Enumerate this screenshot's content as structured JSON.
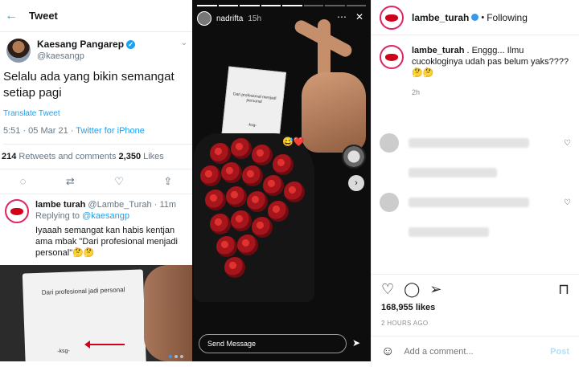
{
  "tweet": {
    "header_title": "Tweet",
    "author_name": "Kaesang Pangarep",
    "author_handle": "@kaesangp",
    "text": "Selalu ada yang bikin semangat setiap pagi",
    "translate_label": "Translate Tweet",
    "timestamp": "5:51 · 05 Mar 21 · ",
    "source": "Twitter for iPhone",
    "retweets_count": "214",
    "retweets_label": " Retweets and comments ",
    "likes_count": "2,350",
    "likes_label": " Likes",
    "reply": {
      "author_name": "lambe turah",
      "author_handle": "@Lambe_Turah · 11m",
      "replying_prefix": "Replying to ",
      "replying_to": "@kaesangp",
      "text": "Iyaaah semangat kan habis kentjan ama mbak \"Dari profesional menjadi personal\"🤔🤔"
    }
  },
  "left_photo": {
    "card_title": "Dari profesional jadi personal",
    "card_signature": "-ksg-"
  },
  "story": {
    "username": "nadrifta",
    "time": "15h",
    "note_title": "Dari profesional menjadi personal",
    "note_signature": "-ksg-",
    "emoji": "😅❤️",
    "reply_placeholder": "Send Message"
  },
  "instagram": {
    "username": "lambe_turah",
    "dot": "•",
    "follow_status": "Following",
    "caption_user": "lambe_turah",
    "caption_text": " . Enggg... Ilmu cucokloginya udah pas belum yaks???? 🤔🤔",
    "caption_age": "2h",
    "likes": "168,955 likes",
    "time_ago": "2 HOURS AGO",
    "comment_placeholder": "Add a comment...",
    "post_label": "Post"
  },
  "icons": {
    "back": "←",
    "chevron": "⌄",
    "reply": "◌",
    "retweet": "⇄",
    "like": "♡",
    "share": "⇪",
    "story_more": "⋯",
    "story_close": "✕",
    "story_next": "›",
    "send": "➤",
    "heart": "♡",
    "comment": "◯",
    "share_ig": "➢",
    "save": "⊓",
    "emoji": "☺"
  }
}
